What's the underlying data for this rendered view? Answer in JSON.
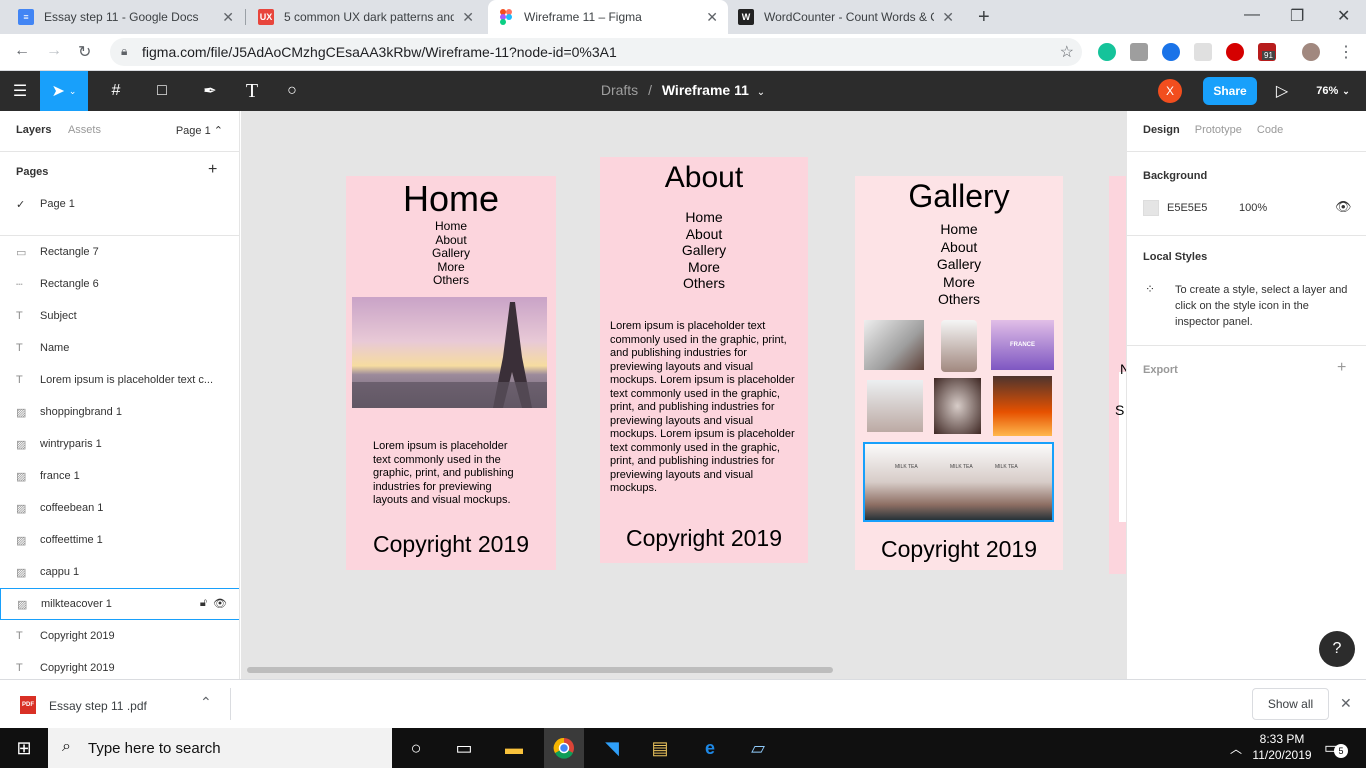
{
  "browser": {
    "tabs": [
      {
        "title": "Essay step 11 - Google Docs",
        "icon": "docs-icon",
        "color": "#4285f4"
      },
      {
        "title": "5 common UX dark patterns and",
        "icon": "ux-icon",
        "color": "#e8453c"
      },
      {
        "title": "Wireframe 11 – Figma",
        "icon": "figma-icon",
        "color": "#f24e1e"
      },
      {
        "title": "WordCounter - Count Words & C",
        "icon": "wordcounter-icon",
        "color": "#222222"
      }
    ],
    "url": "figma.com/file/J5AdAoCMzhgCEsaAA3kRbw/Wireframe-11?node-id=0%3A1",
    "ext_badge": "91"
  },
  "figma": {
    "drafts": "Drafts",
    "separator": "/",
    "file_name": "Wireframe 11",
    "avatar": "X",
    "share": "Share",
    "zoom": "76%",
    "accent": "#18a0fb"
  },
  "left": {
    "tab_layers": "Layers",
    "tab_assets": "Assets",
    "page_selector": "Page 1",
    "pages_header": "Pages",
    "pages": [
      "Page 1"
    ],
    "layers": [
      {
        "name": "Rectangle 7",
        "icon": "rect"
      },
      {
        "name": "Rectangle 6",
        "icon": "line"
      },
      {
        "name": "Subject",
        "icon": "text"
      },
      {
        "name": "Name",
        "icon": "text"
      },
      {
        "name": "Lorem ipsum is placeholder text c...",
        "icon": "text"
      },
      {
        "name": "shoppingbrand 1",
        "icon": "image"
      },
      {
        "name": "wintryparis 1",
        "icon": "image"
      },
      {
        "name": "france 1",
        "icon": "image"
      },
      {
        "name": "coffeebean  1",
        "icon": "image"
      },
      {
        "name": "coffeettime 1",
        "icon": "image"
      },
      {
        "name": "cappu 1",
        "icon": "image"
      },
      {
        "name": "milkteacover  1",
        "icon": "image",
        "selected": true
      },
      {
        "name": "Copyright 2019",
        "icon": "text"
      },
      {
        "name": "Copyright 2019",
        "icon": "text"
      }
    ]
  },
  "canvas": {
    "home": {
      "title": "Home",
      "nav": [
        "Home",
        "About",
        "Gallery",
        "More",
        "Others"
      ],
      "lorem": "Lorem ipsum is placeholder text commonly used in the graphic, print, and publishing industries for previewing layouts and visual mockups.",
      "copyright": "Copyright 2019"
    },
    "about": {
      "title": "About",
      "nav": [
        "Home",
        "About",
        "Gallery",
        "More",
        "Others"
      ],
      "lorem": "Lorem ipsum is placeholder text commonly used in the graphic, print, and publishing industries for previewing layouts and visual mockups. Lorem ipsum is placeholder text commonly used in the graphic, print, and publishing industries for previewing layouts and visual mockups. Lorem ipsum is placeholder text commonly used in the graphic, print, and publishing industries for previewing layouts and visual mockups.",
      "copyright": "Copyright 2019"
    },
    "gallery": {
      "title": "Gallery",
      "nav": [
        "Home",
        "About",
        "Gallery",
        "More",
        "Others"
      ],
      "photo_france_label": "FRANCE",
      "milk_tea_label": "MILK TEA",
      "copyright": "Copyright 2019"
    },
    "partial_frame_letters": [
      "N",
      "S"
    ],
    "frame_color": "#fcd5dd"
  },
  "right": {
    "tab_design": "Design",
    "tab_prototype": "Prototype",
    "tab_code": "Code",
    "background_header": "Background",
    "bg_hex": "E5E5E5",
    "bg_opacity": "100%",
    "local_styles_header": "Local Styles",
    "local_styles_hint": "To create a style, select a layer and click on the style icon in the inspector panel.",
    "export_header": "Export",
    "help": "?"
  },
  "downloads": {
    "file": "Essay step 11 .pdf",
    "show_all": "Show all"
  },
  "taskbar": {
    "search_placeholder": "Type here to search",
    "time": "8:33 PM",
    "date": "11/20/2019",
    "notifications": "5"
  }
}
